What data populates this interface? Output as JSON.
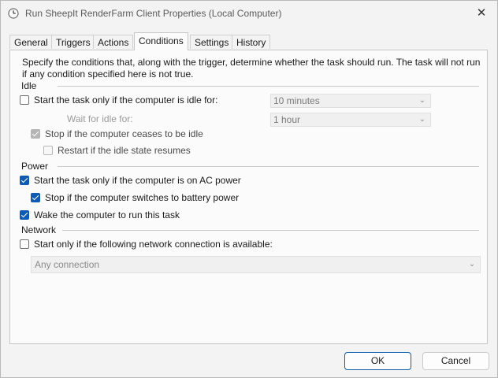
{
  "window": {
    "title": "Run SheepIt RenderFarm Client Properties (Local Computer)",
    "close_glyph": "✕",
    "title_icon": "clock-icon"
  },
  "tabs": [
    {
      "label": "General",
      "active": false
    },
    {
      "label": "Triggers",
      "active": false
    },
    {
      "label": "Actions",
      "active": false
    },
    {
      "label": "Conditions",
      "active": true
    },
    {
      "label": "Settings",
      "active": false
    },
    {
      "label": "History",
      "active": false
    }
  ],
  "description": "Specify the conditions that, along with the trigger, determine whether the task should run.  The task will not run  if any condition specified here is not true.",
  "idle": {
    "group_label": "Idle",
    "start_idle": {
      "label": "Start the task only if the computer is idle for:",
      "checked": false
    },
    "idle_duration": {
      "value": "10 minutes"
    },
    "wait_label": "Wait for idle for:",
    "wait_duration": {
      "value": "1 hour"
    },
    "stop_idle": {
      "label": "Stop if the computer ceases to be idle",
      "checked": true
    },
    "restart_idle": {
      "label": "Restart if the idle state resumes",
      "checked": false
    }
  },
  "power": {
    "group_label": "Power",
    "ac_power": {
      "label": "Start the task only if the computer is on AC power",
      "checked": true
    },
    "battery": {
      "label": "Stop if the computer switches to battery power",
      "checked": true
    },
    "wake": {
      "label": "Wake the computer to run this task",
      "checked": true
    }
  },
  "network": {
    "group_label": "Network",
    "start_network": {
      "label": "Start only if the following network connection is available:",
      "checked": false
    },
    "connection": {
      "value": "Any connection"
    }
  },
  "buttons": {
    "ok": "OK",
    "cancel": "Cancel"
  },
  "colors": {
    "accent": "#0d5bb5",
    "window_bg": "#f3f3f3",
    "panel_bg": "#fbfbfb"
  }
}
